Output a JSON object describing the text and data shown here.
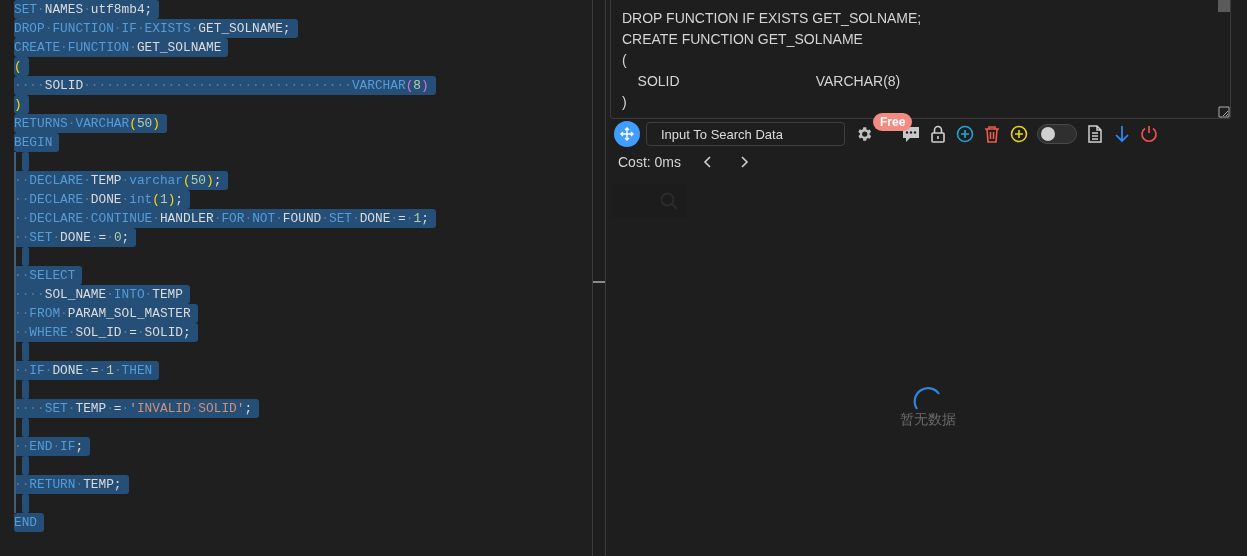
{
  "editor": {
    "lines": [
      {
        "selected": true,
        "tokens": [
          {
            "kind": "kw",
            "text": "SET"
          },
          {
            "kind": "ws",
            "text": "·"
          },
          {
            "kind": "id",
            "text": "NAMES"
          },
          {
            "kind": "ws",
            "text": "·"
          },
          {
            "kind": "id",
            "text": "utf8mb4;"
          }
        ]
      },
      {
        "selected": true,
        "tokens": [
          {
            "kind": "kw",
            "text": "DROP"
          },
          {
            "kind": "ws",
            "text": "·"
          },
          {
            "kind": "kw",
            "text": "FUNCTION"
          },
          {
            "kind": "ws",
            "text": "·"
          },
          {
            "kind": "kw",
            "text": "IF"
          },
          {
            "kind": "ws",
            "text": "·"
          },
          {
            "kind": "kw",
            "text": "EXISTS"
          },
          {
            "kind": "ws",
            "text": "·"
          },
          {
            "kind": "id",
            "text": "GET_SOLNAME;"
          }
        ]
      },
      {
        "selected": true,
        "tokens": [
          {
            "kind": "kw",
            "text": "CREATE"
          },
          {
            "kind": "ws",
            "text": "·"
          },
          {
            "kind": "kw",
            "text": "FUNCTION"
          },
          {
            "kind": "ws",
            "text": "·"
          },
          {
            "kind": "id",
            "text": "GET_SOLNAME"
          }
        ]
      },
      {
        "selected": true,
        "tokens": [
          {
            "kind": "bracket",
            "text": "("
          }
        ]
      },
      {
        "selected": true,
        "tokens": [
          {
            "kind": "ws",
            "text": "····"
          },
          {
            "kind": "id",
            "text": "SOLID"
          },
          {
            "kind": "ws",
            "text": "···································"
          },
          {
            "kind": "kw",
            "text": "VARCHAR"
          },
          {
            "kind": "bracket2",
            "text": "("
          },
          {
            "kind": "num",
            "text": "8"
          },
          {
            "kind": "bracket2",
            "text": ")"
          }
        ]
      },
      {
        "selected": true,
        "tokens": [
          {
            "kind": "bracket",
            "text": ")"
          }
        ]
      },
      {
        "selected": true,
        "tokens": [
          {
            "kind": "kw",
            "text": "RETURNS"
          },
          {
            "kind": "ws",
            "text": "·"
          },
          {
            "kind": "kw",
            "text": "VARCHAR"
          },
          {
            "kind": "bracket",
            "text": "("
          },
          {
            "kind": "num",
            "text": "50"
          },
          {
            "kind": "bracket",
            "text": ")"
          }
        ]
      },
      {
        "selected": true,
        "tokens": [
          {
            "kind": "kw",
            "text": "BEGIN"
          }
        ]
      },
      {
        "selected": true
      },
      {
        "selected": true,
        "tokens": [
          {
            "kind": "ws",
            "text": "··"
          },
          {
            "kind": "kw",
            "text": "DECLARE"
          },
          {
            "kind": "ws",
            "text": "·"
          },
          {
            "kind": "id",
            "text": "TEMP"
          },
          {
            "kind": "ws",
            "text": "·"
          },
          {
            "kind": "kw",
            "text": "varchar"
          },
          {
            "kind": "bracket",
            "text": "("
          },
          {
            "kind": "num",
            "text": "50"
          },
          {
            "kind": "bracket",
            "text": ")"
          },
          {
            "kind": "id",
            "text": ";"
          }
        ]
      },
      {
        "selected": true,
        "tokens": [
          {
            "kind": "ws",
            "text": "··"
          },
          {
            "kind": "kw",
            "text": "DECLARE"
          },
          {
            "kind": "ws",
            "text": "·"
          },
          {
            "kind": "id",
            "text": "DONE"
          },
          {
            "kind": "ws",
            "text": "·"
          },
          {
            "kind": "kw",
            "text": "int"
          },
          {
            "kind": "bracket",
            "text": "("
          },
          {
            "kind": "num",
            "text": "1"
          },
          {
            "kind": "bracket",
            "text": ")"
          },
          {
            "kind": "id",
            "text": ";"
          }
        ]
      },
      {
        "selected": true,
        "tokens": [
          {
            "kind": "ws",
            "text": "··"
          },
          {
            "kind": "kw",
            "text": "DECLARE"
          },
          {
            "kind": "ws",
            "text": "·"
          },
          {
            "kind": "kw",
            "text": "CONTINUE"
          },
          {
            "kind": "ws",
            "text": "·"
          },
          {
            "kind": "id",
            "text": "HANDLER"
          },
          {
            "kind": "ws",
            "text": "·"
          },
          {
            "kind": "kw",
            "text": "FOR"
          },
          {
            "kind": "ws",
            "text": "·"
          },
          {
            "kind": "kw",
            "text": "NOT"
          },
          {
            "kind": "ws",
            "text": "·"
          },
          {
            "kind": "id",
            "text": "FOUND"
          },
          {
            "kind": "ws",
            "text": "·"
          },
          {
            "kind": "kw",
            "text": "SET"
          },
          {
            "kind": "ws",
            "text": "·"
          },
          {
            "kind": "id",
            "text": "DONE"
          },
          {
            "kind": "ws",
            "text": "·"
          },
          {
            "kind": "id",
            "text": "="
          },
          {
            "kind": "ws",
            "text": "·"
          },
          {
            "kind": "num",
            "text": "1"
          },
          {
            "kind": "id",
            "text": ";"
          }
        ]
      },
      {
        "selected": true,
        "tokens": [
          {
            "kind": "ws",
            "text": "··"
          },
          {
            "kind": "kw",
            "text": "SET"
          },
          {
            "kind": "ws",
            "text": "·"
          },
          {
            "kind": "id",
            "text": "DONE"
          },
          {
            "kind": "ws",
            "text": "·"
          },
          {
            "kind": "id",
            "text": "="
          },
          {
            "kind": "ws",
            "text": "·"
          },
          {
            "kind": "num",
            "text": "0"
          },
          {
            "kind": "id",
            "text": ";"
          }
        ]
      },
      {
        "selected": true
      },
      {
        "selected": true,
        "tokens": [
          {
            "kind": "ws",
            "text": "··"
          },
          {
            "kind": "kw",
            "text": "SELECT"
          }
        ]
      },
      {
        "selected": true,
        "tokens": [
          {
            "kind": "ws",
            "text": "····"
          },
          {
            "kind": "id",
            "text": "SOL_NAME"
          },
          {
            "kind": "ws",
            "text": "·"
          },
          {
            "kind": "kw",
            "text": "INTO"
          },
          {
            "kind": "ws",
            "text": "·"
          },
          {
            "kind": "id",
            "text": "TEMP"
          }
        ]
      },
      {
        "selected": true,
        "tokens": [
          {
            "kind": "ws",
            "text": "··"
          },
          {
            "kind": "kw",
            "text": "FROM"
          },
          {
            "kind": "ws",
            "text": "·"
          },
          {
            "kind": "id",
            "text": "PARAM_SOL_MASTER"
          }
        ]
      },
      {
        "selected": true,
        "tokens": [
          {
            "kind": "ws",
            "text": "··"
          },
          {
            "kind": "kw",
            "text": "WHERE"
          },
          {
            "kind": "ws",
            "text": "·"
          },
          {
            "kind": "id",
            "text": "SOL_ID"
          },
          {
            "kind": "ws",
            "text": "·"
          },
          {
            "kind": "id",
            "text": "="
          },
          {
            "kind": "ws",
            "text": "·"
          },
          {
            "kind": "id",
            "text": "SOLID;"
          }
        ]
      },
      {
        "selected": true
      },
      {
        "selected": true,
        "tokens": [
          {
            "kind": "ws",
            "text": "··"
          },
          {
            "kind": "kw",
            "text": "IF"
          },
          {
            "kind": "ws",
            "text": "·"
          },
          {
            "kind": "id",
            "text": "DONE"
          },
          {
            "kind": "ws",
            "text": "·"
          },
          {
            "kind": "id",
            "text": "="
          },
          {
            "kind": "ws",
            "text": "·"
          },
          {
            "kind": "num",
            "text": "1"
          },
          {
            "kind": "ws",
            "text": "·"
          },
          {
            "kind": "kw",
            "text": "THEN"
          }
        ]
      },
      {
        "selected": true
      },
      {
        "selected": true,
        "tokens": [
          {
            "kind": "ws",
            "text": "····"
          },
          {
            "kind": "kw",
            "text": "SET"
          },
          {
            "kind": "ws",
            "text": "·"
          },
          {
            "kind": "id",
            "text": "TEMP"
          },
          {
            "kind": "ws",
            "text": "·"
          },
          {
            "kind": "id",
            "text": "="
          },
          {
            "kind": "ws",
            "text": "·"
          },
          {
            "kind": "str",
            "text": "'INVALID"
          },
          {
            "kind": "ws",
            "text": "·"
          },
          {
            "kind": "str",
            "text": "SOLID'"
          },
          {
            "kind": "id",
            "text": ";"
          }
        ]
      },
      {
        "selected": true
      },
      {
        "selected": true,
        "tokens": [
          {
            "kind": "ws",
            "text": "··"
          },
          {
            "kind": "kw",
            "text": "END"
          },
          {
            "kind": "ws",
            "text": "·"
          },
          {
            "kind": "kw",
            "text": "IF"
          },
          {
            "kind": "id",
            "text": ";"
          }
        ]
      },
      {
        "selected": true
      },
      {
        "selected": true,
        "tokens": [
          {
            "kind": "ws",
            "text": "··"
          },
          {
            "kind": "kw",
            "text": "RETURN"
          },
          {
            "kind": "ws",
            "text": "·"
          },
          {
            "kind": "id",
            "text": "TEMP;"
          }
        ]
      },
      {
        "selected": true
      },
      {
        "selected": true,
        "tokens": [
          {
            "kind": "kw",
            "text": "END"
          }
        ]
      }
    ]
  },
  "preview": {
    "lines": [
      "DROP FUNCTION IF EXISTS GET_SOLNAME;",
      "CREATE FUNCTION GET_SOLNAME",
      "(",
      "    SOLID                                   VARCHAR(8)",
      ")"
    ]
  },
  "toolbar": {
    "search": {
      "placeholder": "Input To Search Data"
    },
    "badge": "Free",
    "toggle": {
      "on": false
    }
  },
  "results": {
    "cost": "Cost: 0ms",
    "loading": true,
    "empty_text": "暂无数据"
  }
}
